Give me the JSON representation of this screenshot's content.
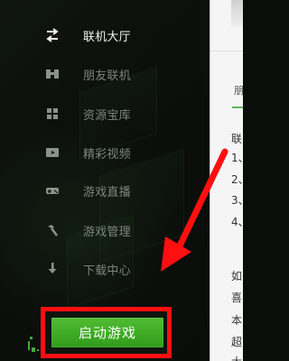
{
  "sidebar": {
    "items": [
      {
        "label": "联机大厅",
        "icon": "swap-arrows-icon",
        "active": true
      },
      {
        "label": "朋友联机",
        "icon": "binoculars-icon",
        "active": false
      },
      {
        "label": "资源宝库",
        "icon": "grid-icon",
        "active": false
      },
      {
        "label": "精彩视频",
        "icon": "play-icon",
        "active": false
      },
      {
        "label": "游戏直播",
        "icon": "gamepad-icon",
        "active": false
      },
      {
        "label": "游戏管理",
        "icon": "pickaxe-icon",
        "active": false
      },
      {
        "label": "下载中心",
        "icon": "download-icon",
        "active": false
      }
    ]
  },
  "action": {
    "start_button_label": "启动游戏"
  },
  "panel": {
    "tab_mark": "朋",
    "lines": [
      "联",
      "1、",
      "2、",
      "3、",
      "4、"
    ],
    "bottom_lines": [
      "如",
      "喜",
      "本",
      "超",
      "大"
    ]
  },
  "colors": {
    "highlight_red": "#ff0f10",
    "button_green": "#3aad25",
    "active_text": "#f3f3f3",
    "inactive_text": "#7c857c"
  }
}
